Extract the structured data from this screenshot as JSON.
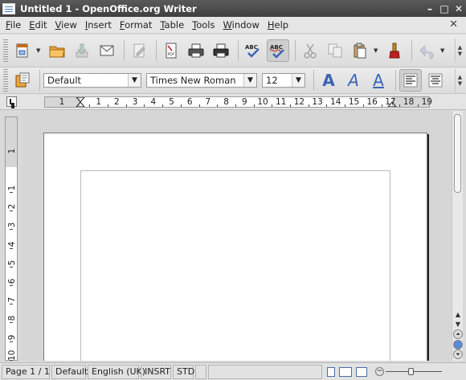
{
  "window": {
    "title": "Untitled 1 - OpenOffice.org Writer",
    "controls": {
      "minimize": "–",
      "maximize": "□",
      "close": "✕"
    }
  },
  "menu": {
    "items": [
      "File",
      "Edit",
      "View",
      "Insert",
      "Format",
      "Table",
      "Tools",
      "Window",
      "Help"
    ],
    "close_document": "✕"
  },
  "standard_toolbar": {
    "buttons": [
      {
        "name": "new-document",
        "icon": "new-document-icon"
      },
      {
        "name": "open",
        "icon": "folder-open-icon"
      },
      {
        "name": "save",
        "icon": "save-icon"
      },
      {
        "name": "email",
        "icon": "email-icon"
      },
      {
        "name": "edit-file",
        "icon": "edit-file-icon"
      },
      {
        "name": "export-pdf",
        "icon": "pdf-icon"
      },
      {
        "name": "print",
        "icon": "printer-icon"
      },
      {
        "name": "print-preview",
        "icon": "print-preview-icon"
      },
      {
        "name": "spellcheck",
        "icon": "spellcheck-icon"
      },
      {
        "name": "auto-spellcheck",
        "icon": "auto-spellcheck-icon",
        "pressed": true
      },
      {
        "name": "cut",
        "icon": "scissors-icon"
      },
      {
        "name": "copy",
        "icon": "copy-icon"
      },
      {
        "name": "paste",
        "icon": "paste-icon"
      },
      {
        "name": "format-paintbrush",
        "icon": "paintbrush-icon"
      },
      {
        "name": "undo",
        "icon": "undo-icon"
      }
    ]
  },
  "formatting_toolbar": {
    "paragraph_style": "Default",
    "font_name": "Times New Roman",
    "font_size": "12",
    "bold_label": "A",
    "italic_label": "A",
    "underline_label": "A"
  },
  "ruler": {
    "horizontal_labels": [
      "1",
      "1",
      "2",
      "3",
      "4",
      "5",
      "6",
      "7",
      "8",
      "9",
      "10",
      "11",
      "12",
      "13",
      "14",
      "15",
      "16",
      "17",
      "18",
      "19"
    ],
    "vertical_labels": [
      "1",
      "1",
      "2",
      "3",
      "4",
      "5",
      "6",
      "7",
      "8",
      "9",
      "10"
    ]
  },
  "status": {
    "page": "Page 1 / 1",
    "style": "Default",
    "language": "English (UK)",
    "insert_mode": "INSRT",
    "selection_mode": "STD"
  },
  "colors": {
    "accent": "#3a64b6",
    "titlebar": "#4a4a4a",
    "workspace": "#d6d6d6"
  }
}
